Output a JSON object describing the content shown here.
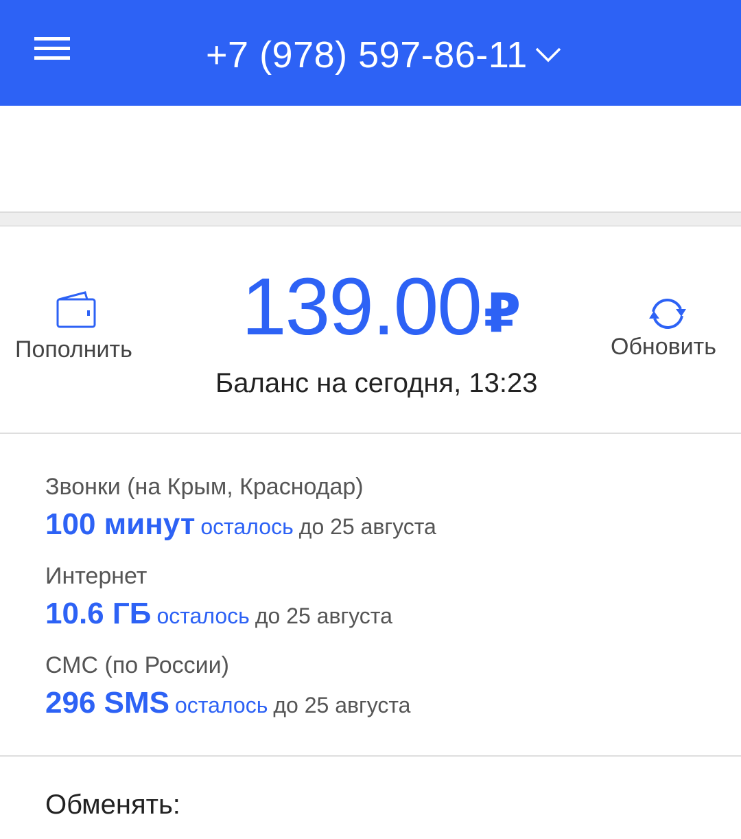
{
  "header": {
    "phone_number": "+7 (978) 597-86-11",
    "menu_icon": "hamburger-menu-icon",
    "dropdown_icon": "chevron-down-icon",
    "accent_color": "#2d62f5"
  },
  "balance": {
    "amount": "139.00",
    "currency_symbol": "₽",
    "caption": "Баланс на сегодня, 13:23",
    "topup_label": "Пополнить",
    "topup_icon": "wallet-icon",
    "refresh_label": "Обновить",
    "refresh_icon": "refresh-icon"
  },
  "quotas": [
    {
      "title": "Звонки (на Крым, Краснодар)",
      "amount": "100 минут",
      "remaining_label": "осталось",
      "until": "до 25 августа"
    },
    {
      "title": "Интернет",
      "amount": "10.6 ГБ",
      "remaining_label": "осталось",
      "until": "до 25 августа"
    },
    {
      "title": "СМС (по России)",
      "amount": "296 SMS",
      "remaining_label": "осталось",
      "until": "до 25 августа"
    }
  ],
  "exchange": {
    "title": "Обменять:"
  }
}
